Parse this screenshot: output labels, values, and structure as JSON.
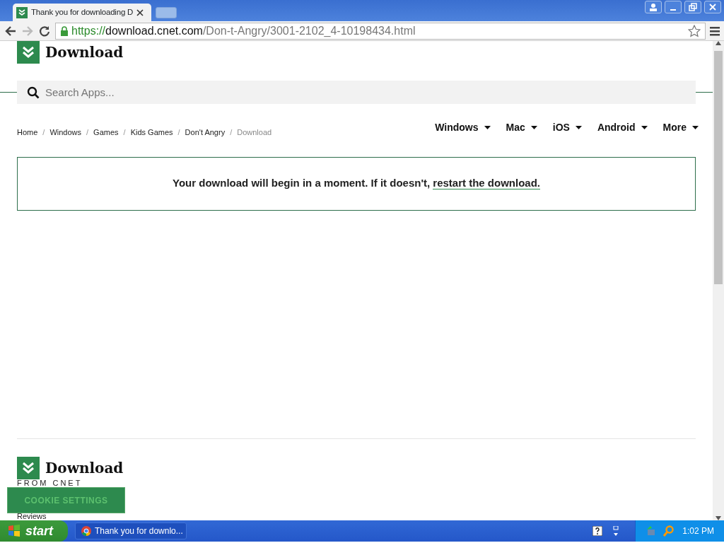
{
  "browser": {
    "tab_title": "Thank you for downloading D",
    "url_scheme": "https://",
    "url_host": "download.cnet.com",
    "url_path": "/Don-t-Angry/3001-2102_4-10198434.html"
  },
  "header": {
    "logo": "Download",
    "search": {
      "placeholder": "Search Apps..."
    }
  },
  "breadcrumb_separator": "/",
  "breadcrumbs": [
    {
      "label": "Home",
      "current": false
    },
    {
      "label": "Windows",
      "current": false
    },
    {
      "label": "Games",
      "current": false
    },
    {
      "label": "Kids Games",
      "current": false
    },
    {
      "label": "Don't Angry",
      "current": false
    },
    {
      "label": "Download",
      "current": true
    }
  ],
  "nav": [
    "Windows",
    "Mac",
    "iOS",
    "Android",
    "More"
  ],
  "notice": {
    "text": "Your download will begin in a moment. If it doesn't, ",
    "link": "restart the download."
  },
  "footer": {
    "logo": "Download",
    "tagline": "FROM CNET",
    "link": "Reviews"
  },
  "cookie_button": "COOKIE SETTINGS",
  "taskbar": {
    "start": "start",
    "window": "Thank you for downlo...",
    "clock": "1:02 PM"
  }
}
